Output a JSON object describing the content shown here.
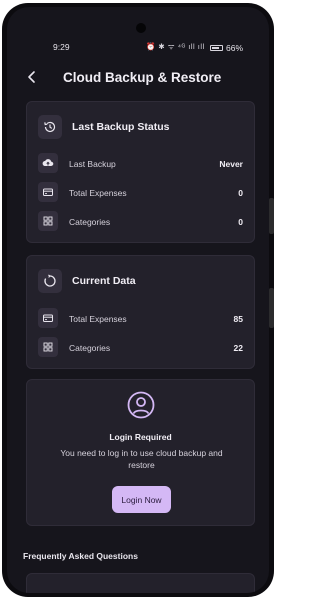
{
  "status_bar": {
    "time": "9:29",
    "icons": "⏰ ✱ ᯤ ⁴ᴳ ıll ıll",
    "battery": "66%"
  },
  "header": {
    "back_icon": "arrow-left-icon",
    "title": "Cloud Backup & Restore"
  },
  "last_backup_status": {
    "title": "Last Backup Status",
    "icon": "history-icon",
    "rows": [
      {
        "icon": "cloud-upload-icon",
        "label": "Last Backup",
        "value": "Never"
      },
      {
        "icon": "credit-card-icon",
        "label": "Total Expenses",
        "value": "0"
      },
      {
        "icon": "grid-icon",
        "label": "Categories",
        "value": "0"
      }
    ]
  },
  "current_data": {
    "title": "Current Data",
    "icon": "sync-icon",
    "rows": [
      {
        "icon": "credit-card-icon",
        "label": "Total Expenses",
        "value": "85"
      },
      {
        "icon": "grid-icon",
        "label": "Categories",
        "value": "22"
      }
    ]
  },
  "login_card": {
    "icon": "account-circle-icon",
    "title": "Login Required",
    "message": "You need to log in to use cloud backup and restore",
    "button_label": "Login Now"
  },
  "faq": {
    "heading": "Frequently Asked Questions"
  },
  "colors": {
    "background": "#16151c",
    "card": "#23212b",
    "icon_box": "#332f3d",
    "accent": "#d4b8f5"
  }
}
